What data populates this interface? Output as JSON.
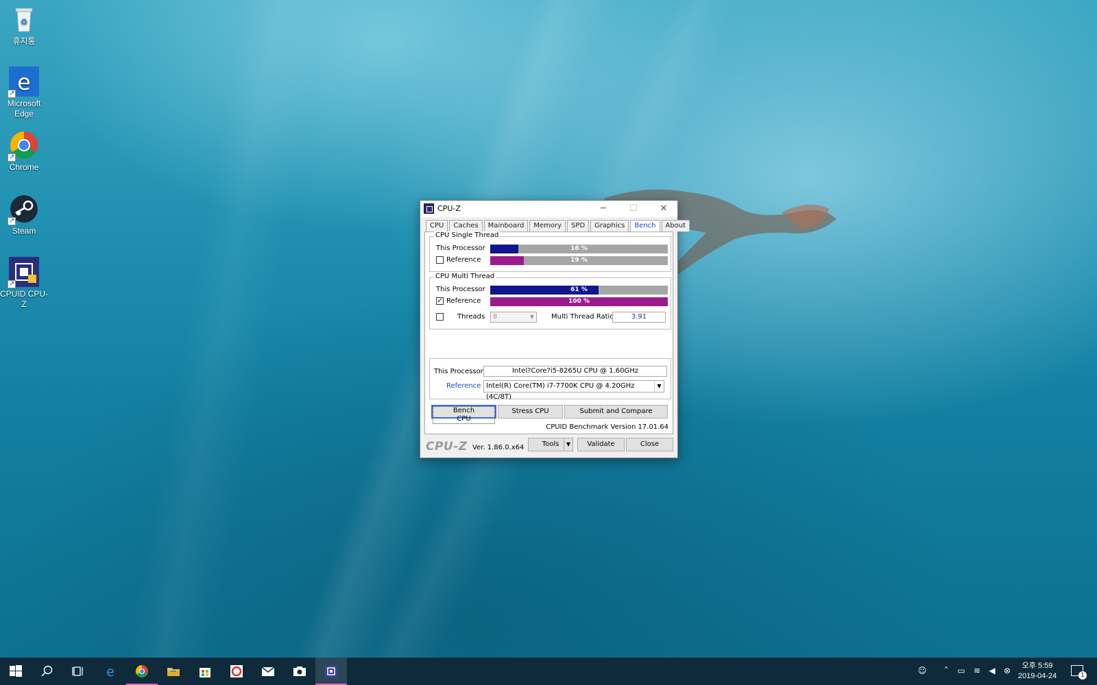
{
  "desktop": {
    "icons": [
      {
        "label": "휴지통"
      },
      {
        "label": "Microsoft Edge"
      },
      {
        "label": "Chrome"
      },
      {
        "label": "Steam"
      },
      {
        "label": "CPUID CPU-Z"
      }
    ]
  },
  "window": {
    "title": "CPU-Z",
    "tabs": [
      "CPU",
      "Caches",
      "Mainboard",
      "Memory",
      "SPD",
      "Graphics",
      "Bench",
      "About"
    ],
    "active_tab": "Bench",
    "single_thread": {
      "title": "CPU Single Thread",
      "this_label": "This Processor",
      "this_value": 0.16,
      "this_pct": "16 %",
      "ref_label": "Reference",
      "ref_checked": false,
      "ref_value": 0.19,
      "ref_pct": "19 %"
    },
    "multi_thread": {
      "title": "CPU Multi Thread",
      "this_label": "This Processor",
      "this_value": 0.61,
      "this_pct": "61 %",
      "ref_label": "Reference",
      "ref_checked": true,
      "ref_value": 1.0,
      "ref_pct": "100 %",
      "threads_label": "Threads",
      "threads_value": "8",
      "ratio_label": "Multi Thread Ratio",
      "ratio_value": "3.91"
    },
    "processor": {
      "this_label": "This Processor",
      "this_value": "Intel?Core?i5-8265U CPU @ 1.60GHz",
      "ref_label": "Reference",
      "ref_value": "Intel(R) Core(TM) i7-7700K CPU @ 4.20GHz (4C/8T)"
    },
    "buttons": {
      "bench": "Bench CPU",
      "stress": "Stress CPU",
      "submit": "Submit and Compare"
    },
    "bench_version": "CPUID Benchmark Version 17.01.64",
    "footer": {
      "logo": "CPU-Z",
      "version": "Ver. 1.86.0.x64",
      "tools": "Tools",
      "validate": "Validate",
      "close": "Close"
    },
    "colors": {
      "this_bar": "#10168c",
      "ref_bar": "#9c1b8c",
      "track": "#a6a6a6"
    }
  },
  "taskbar": {
    "time": "오후 5:59",
    "date": "2019-04-24",
    "notification_count": "1",
    "apps": [
      "windows-start-icon",
      "search-icon",
      "task-view-icon",
      "edge-icon",
      "chrome-icon",
      "file-explorer-icon",
      "store-icon",
      "sync-app-icon",
      "mail-icon",
      "camera-icon",
      "cpu-z-icon"
    ]
  }
}
